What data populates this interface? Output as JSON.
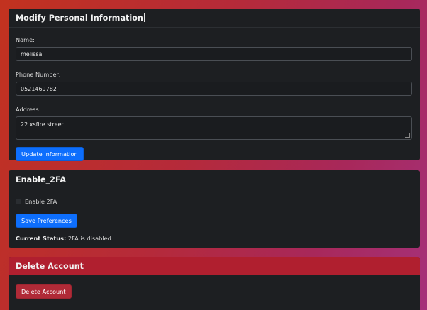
{
  "personal": {
    "title": "Modify Personal Information",
    "name_label": "Name:",
    "name_value": "melissa",
    "phone_label": "Phone Number:",
    "phone_value": "0521469782",
    "address_label": "Address:",
    "address_value": "22 xsfire street",
    "update_button": "Update Information"
  },
  "twofa": {
    "title": "Enable_2FA",
    "checkbox_label": "Enable 2FA",
    "checkbox_checked": false,
    "save_button": "Save Preferences",
    "status_label": "Current Status:",
    "status_value": "2FA is disabled"
  },
  "delete": {
    "title": "Delete Account",
    "delete_button": "Delete Account"
  },
  "colors": {
    "primary": "#0d6efd",
    "danger": "#b02a37",
    "card": "#1d1f22"
  }
}
